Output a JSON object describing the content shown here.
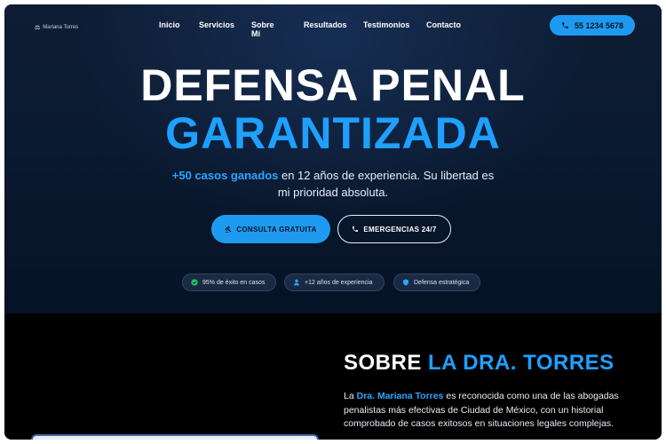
{
  "nav": {
    "logo_text": "Mariana Torres",
    "links": [
      "Inicio",
      "Servicios",
      "Sobre Mí",
      "Resultados",
      "Testimonios",
      "Contacto"
    ],
    "phone": "55 1234 5678"
  },
  "hero": {
    "title_line1": "DEFENSA PENAL",
    "title_line2": "GARANTIZADA",
    "subtitle_highlight": "+50 casos ganados",
    "subtitle_rest_line1": " en 12 años de experiencia. Su libertad es",
    "subtitle_line2": "mi prioridad absoluta.",
    "cta_primary": "CONSULTA GRATUITA",
    "cta_secondary": "EMERGENCIAS 24/7",
    "badges": [
      "95% de éxito en casos",
      "+12 años de experiencia",
      "Defensa estratégica"
    ]
  },
  "about": {
    "title_prefix": "SOBRE ",
    "title_accent": "LA DRA. TORRES",
    "text_prefix": "La ",
    "name": "Dra. Mariana Torres",
    "text_rest": " es reconocida como una de las abogadas penalistas más efectivas de Ciudad de México, con un historial comprobado de casos exitosos en situaciones legales complejas."
  },
  "colors": {
    "accent": "#1e9bf0",
    "hero_bg": "#0a1a30",
    "section_bg": "#000000"
  },
  "icons": {
    "logo": "scales-icon",
    "phone": "phone-icon",
    "consult": "gavel-icon",
    "badge_success": "check-circle-icon",
    "badge_experience": "user-icon",
    "badge_strategy": "shield-icon"
  }
}
